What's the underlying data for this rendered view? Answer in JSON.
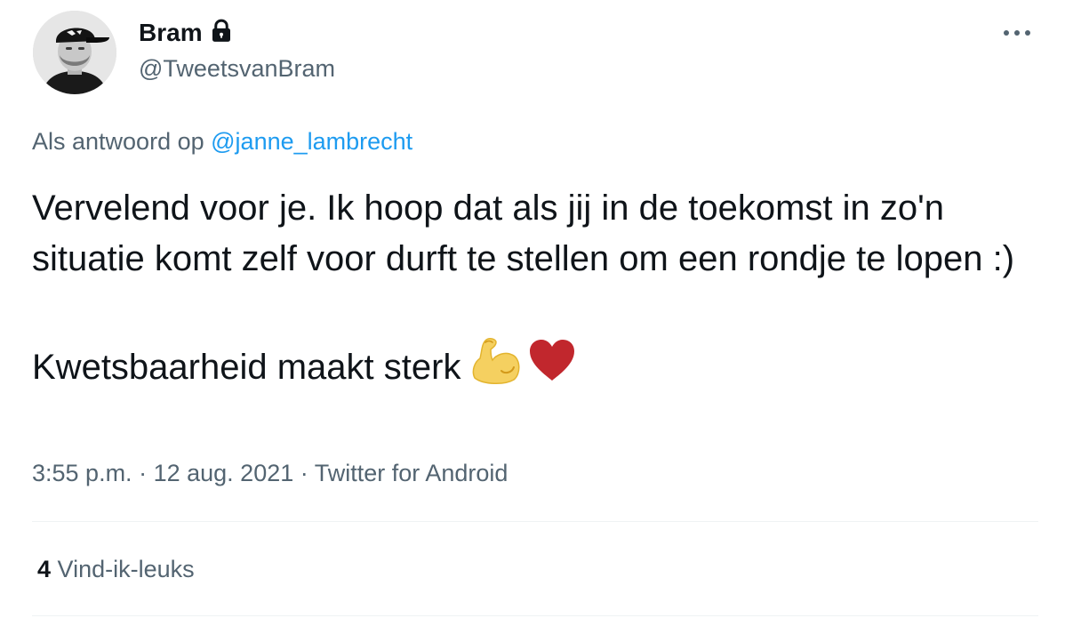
{
  "author": {
    "display_name": "Bram",
    "handle": "@TweetsvanBram",
    "protected_icon": "lock-icon",
    "avatar": "profile-photo"
  },
  "menu": {
    "more_icon": "more-horizontal-icon"
  },
  "reply_context": {
    "prefix": "Als antwoord op",
    "mention": "@janne_lambrecht"
  },
  "tweet": {
    "paragraph1": "Vervelend voor je. Ik hoop dat als jij in de toekomst in zo'n situatie komt zelf voor durft te stellen om een rondje te lopen :)",
    "paragraph2": "Kwetsbaarheid maakt sterk",
    "emojis": [
      "flexed-biceps-emoji",
      "red-heart-emoji"
    ]
  },
  "meta": {
    "time": "3:55 p.m.",
    "separator": "·",
    "date": "12 aug. 2021",
    "source": "Twitter for Android"
  },
  "stats": {
    "likes_count": "4",
    "likes_label": "Vind-ik-leuks"
  },
  "colors": {
    "text_primary": "#0f1419",
    "text_secondary": "#536471",
    "link": "#1d9bf0",
    "divider": "#eff3f4"
  }
}
